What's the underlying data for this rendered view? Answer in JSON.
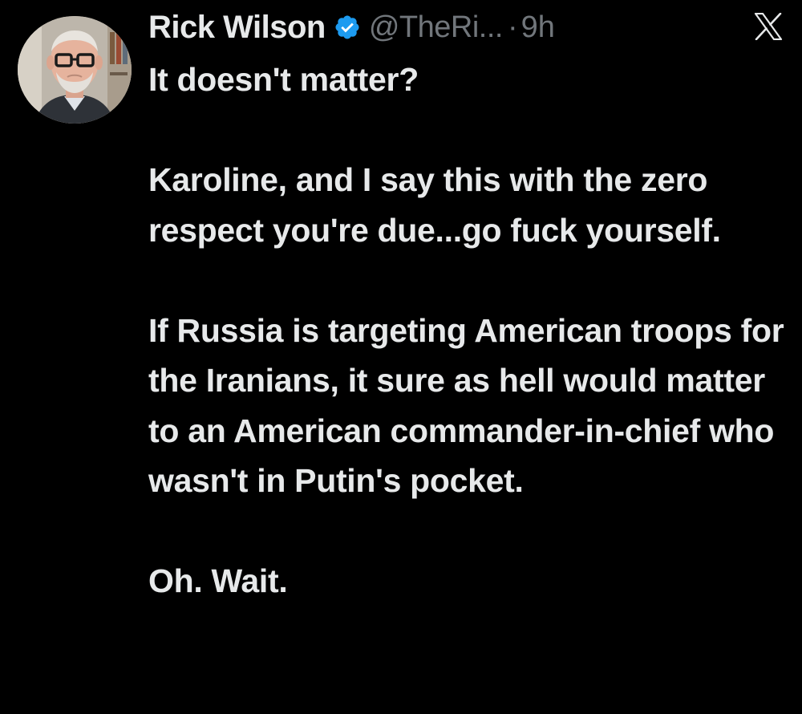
{
  "tweet": {
    "author": {
      "name": "Rick Wilson",
      "handle": "@TheRi...",
      "verified": true
    },
    "separator": "·",
    "timestamp": "9h",
    "platform_icon": "x-logo-icon",
    "body_paragraphs": [
      "It doesn't matter?",
      "Karoline, and I say this with the zero respect you're due...go fuck yourself.",
      "If Russia is targeting American troops for the Iranians, it sure as hell would matter to an American commander-in-chief who wasn't in Putin's pocket.",
      "Oh. Wait."
    ]
  },
  "colors": {
    "background": "#000000",
    "text_primary": "#e7e9ea",
    "text_secondary": "#71767b",
    "verified_badge": "#1d9bf0"
  }
}
